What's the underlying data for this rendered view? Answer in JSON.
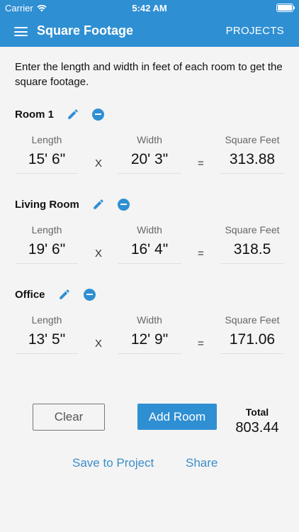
{
  "status_bar": {
    "carrier": "Carrier",
    "time": "5:42 AM"
  },
  "nav": {
    "title": "Square Footage",
    "projects": "PROJECTS"
  },
  "instructions": "Enter the length and width in feet of each room to get the square footage.",
  "columns": {
    "length": "Length",
    "width": "Width",
    "square_feet": "Square Feet"
  },
  "operators": {
    "times": "X",
    "equals": "="
  },
  "rooms": [
    {
      "name": "Room 1",
      "length": "15' 6\"",
      "width": "20' 3\"",
      "square_feet": "313.88"
    },
    {
      "name": "Living Room",
      "length": "19' 6\"",
      "width": "16' 4\"",
      "square_feet": "318.5"
    },
    {
      "name": "Office",
      "length": "13' 5\"",
      "width": "12' 9\"",
      "square_feet": "171.06"
    }
  ],
  "actions": {
    "clear": "Clear",
    "add_room": "Add Room"
  },
  "total": {
    "label": "Total",
    "value": "803.44"
  },
  "links": {
    "save": "Save to Project",
    "share": "Share"
  },
  "colors": {
    "accent": "#2f8fd3",
    "link": "#3a8ec9"
  }
}
